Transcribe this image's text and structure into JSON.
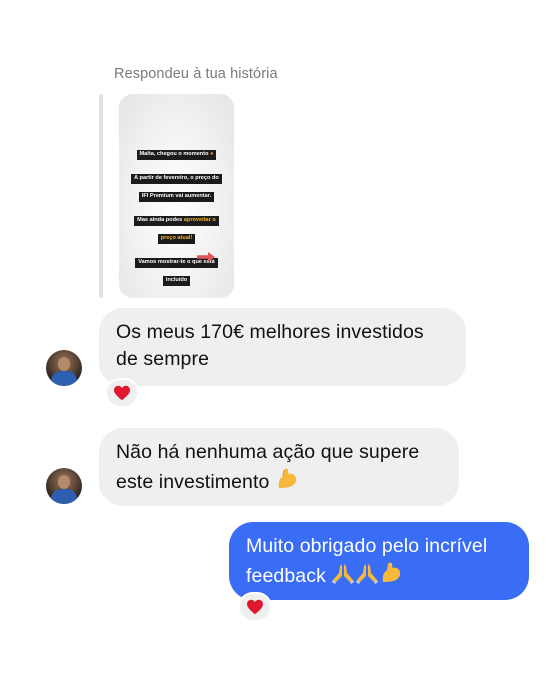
{
  "chat": {
    "reply_label": "Respondeu à tua história",
    "story": {
      "line1": "Malta, chegou o momento",
      "line2a": "A partir de fevereiro, o preço do",
      "line2b": "IFI Premium vai aumentar.",
      "line3a": "Mas ainda podes",
      "line3b": "aproveitar o",
      "line3c": "preço atual!",
      "line4a": "Vamos mostrar-te o que está",
      "line4b": "incluído"
    },
    "messages": [
      {
        "line1": "Os meus 170€ melhores investidos",
        "line2": "de sempre",
        "reaction": "heart-emoji"
      },
      {
        "line1": "Não há nenhuma ação que supere",
        "line2": "este investimento",
        "emoji": "flexed-biceps-emoji"
      },
      {
        "line1": "Muito obrigado pelo incrível",
        "line2": "feedback",
        "emoji": "praying-hands-x2-flexed-biceps",
        "reaction": "heart-emoji"
      }
    ]
  },
  "colors": {
    "outgoing_bubble": "#3a6df5",
    "incoming_bubble": "#efefef",
    "reaction_heart": "#e0182d",
    "label_gray": "#7a7a7a"
  }
}
